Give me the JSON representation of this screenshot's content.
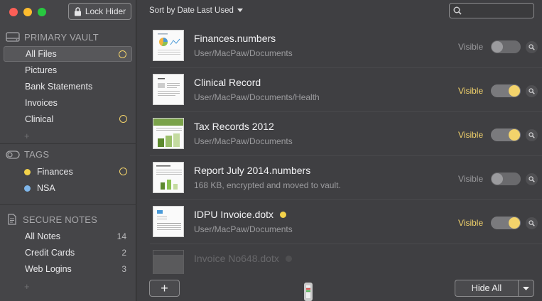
{
  "window": {
    "lock_button_label": "Lock Hider"
  },
  "sidebar": {
    "primary_vault": {
      "heading": "PRIMARY VAULT",
      "items": [
        {
          "label": "All Files",
          "selected": true,
          "ring": true
        },
        {
          "label": "Pictures"
        },
        {
          "label": "Bank Statements"
        },
        {
          "label": "Invoices"
        },
        {
          "label": "Clinical",
          "ring": true
        }
      ],
      "add_label": "+"
    },
    "tags": {
      "heading": "TAGS",
      "items": [
        {
          "label": "Finances",
          "color": "#f3d24a",
          "ring": true
        },
        {
          "label": "NSA",
          "color": "#7fb6ea"
        }
      ]
    },
    "secure_notes": {
      "heading": "SECURE NOTES",
      "items": [
        {
          "label": "All Notes",
          "count": "14"
        },
        {
          "label": "Credit Cards",
          "count": "2"
        },
        {
          "label": "Web Logins",
          "count": "3"
        }
      ],
      "add_label": "+"
    }
  },
  "toolbar": {
    "sort_label": "Sort by Date Last Used",
    "search_placeholder": ""
  },
  "files": [
    {
      "name": "Finances.numbers",
      "path": "User/MacPaw/Documents",
      "visible_label": "Visible",
      "visible": false,
      "tag_dot": false
    },
    {
      "name": "Clinical Record",
      "path": "User/MacPaw/Documents/Health",
      "visible_label": "Visible",
      "visible": true,
      "tag_dot": false
    },
    {
      "name": "Tax Records 2012",
      "path": "User/MacPaw/Documents",
      "visible_label": "Visible",
      "visible": true,
      "tag_dot": false
    },
    {
      "name": "Report July 2014.numbers",
      "path": "168 KB, encrypted and moved to vault.",
      "visible_label": "Visible",
      "visible": false,
      "tag_dot": false
    },
    {
      "name": "IDPU Invoice.dotx",
      "path": "User/MacPaw/Documents",
      "visible_label": "Visible",
      "visible": true,
      "tag_dot": true
    },
    {
      "name": "Invoice No648.dotx",
      "path": "",
      "visible_label": "",
      "visible": false,
      "tag_dot": true
    }
  ],
  "bottom": {
    "add_label": "+",
    "hide_all_label": "Hide All"
  },
  "colors": {
    "accent_yellow": "#f3d36b",
    "sidebar_bg": "#454548",
    "main_bg": "#3f3f42"
  }
}
